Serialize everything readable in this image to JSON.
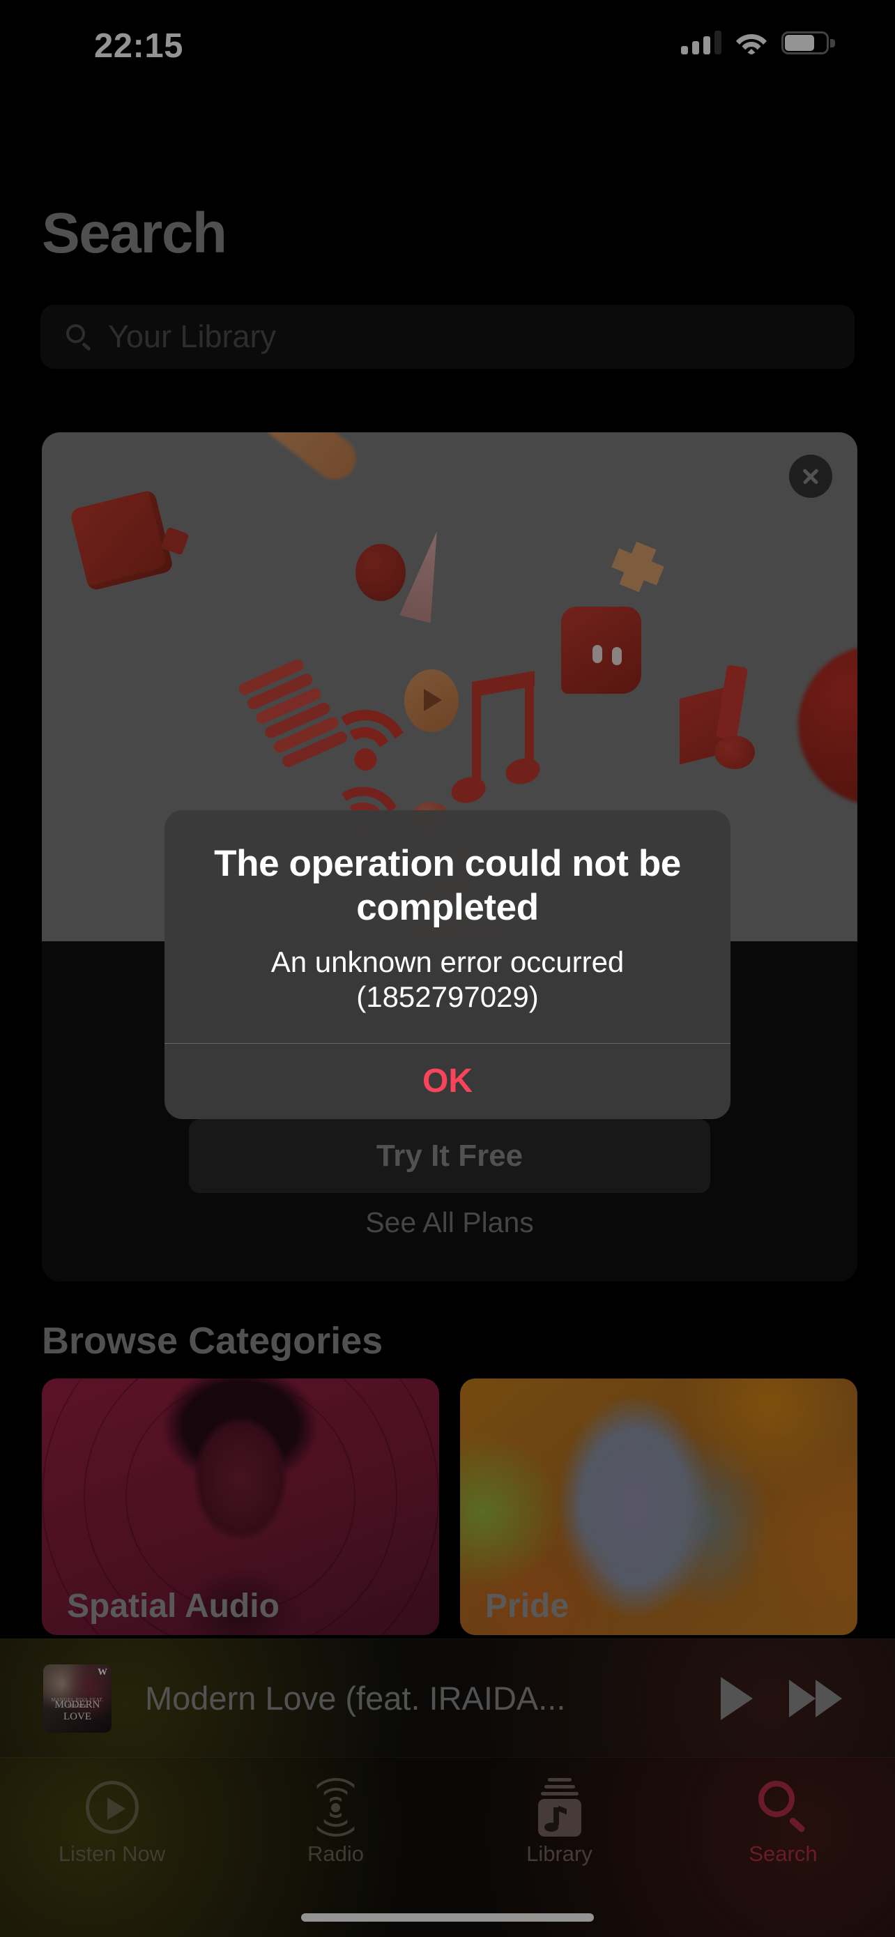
{
  "status_bar": {
    "time": "22:15",
    "signal_icon": "cellular-signal-icon",
    "signal_bars_filled": 3,
    "signal_bars_total": 4,
    "wifi_icon": "wifi-icon",
    "battery_icon": "battery-icon",
    "battery_level_percent": 80
  },
  "header": {
    "title": "Search"
  },
  "search": {
    "placeholder": "Your Library",
    "value": "",
    "icon": "search-icon"
  },
  "promo": {
    "close_icon": "close-icon",
    "artwork_alt": "apple-music-3d-objects-artwork",
    "headline_visible": "...",
    "subtitle_left": "Plus y",
    "subtitle_right": "month",
    "try_button": "Try It Free",
    "see_all_plans": "See All Plans"
  },
  "browse": {
    "section_title": "Browse Categories",
    "cards": [
      {
        "label": "Spatial Audio",
        "art": "spatial-audio-portrait"
      },
      {
        "label": "Pride",
        "art": "pride-gradient"
      }
    ]
  },
  "mini_player": {
    "track_title": "Modern Love (feat. IRAIDA...",
    "artwork_line1": "MANUEL RIVA FEAT. IRAIDA",
    "artwork_line2": "MODERN LOVE",
    "artwork_badge": "W",
    "play_icon": "play-icon",
    "next_icon": "fast-forward-icon"
  },
  "tab_bar": {
    "tabs": [
      {
        "label": "Listen Now",
        "icon": "play-circle-icon",
        "active": false
      },
      {
        "label": "Radio",
        "icon": "broadcast-icon",
        "active": false
      },
      {
        "label": "Library",
        "icon": "library-icon",
        "active": false
      },
      {
        "label": "Search",
        "icon": "search-icon",
        "active": true
      }
    ],
    "active_color": "#b5304a",
    "inactive_color": "#6f6a56"
  },
  "alert": {
    "title": "The operation could not be completed",
    "message": "An unknown error occurred (1852797029)",
    "ok_label": "OK",
    "ok_color": "#f9445b"
  },
  "home_indicator": "home-indicator"
}
